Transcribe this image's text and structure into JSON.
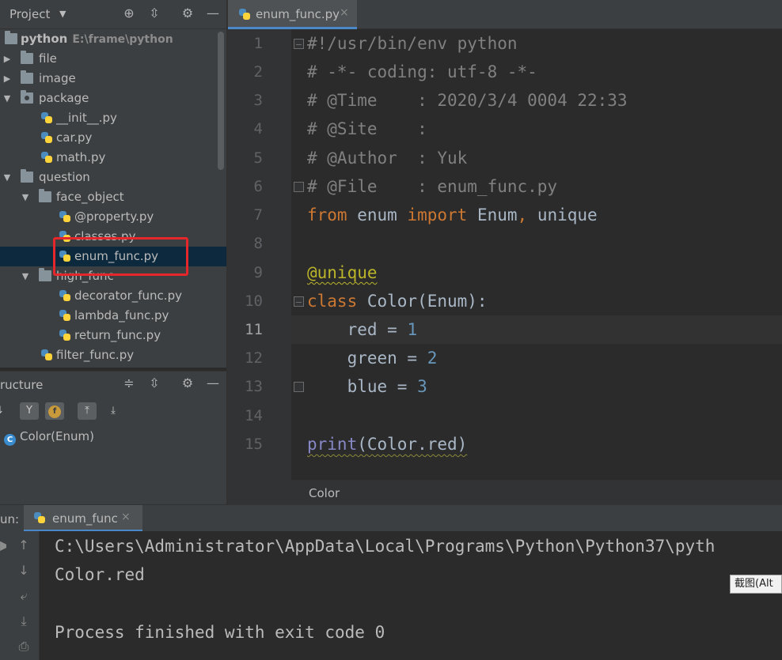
{
  "project_panel": {
    "title": "Project",
    "tree": [
      {
        "label": "python",
        "path": "E:\\frame\\python",
        "type": "folder",
        "expanded": true,
        "bold": true
      },
      {
        "label": "file",
        "type": "folder",
        "expanded": false
      },
      {
        "label": "image",
        "type": "folder",
        "expanded": false
      },
      {
        "label": "package",
        "type": "package",
        "expanded": true
      },
      {
        "label": "__init__.py",
        "type": "py"
      },
      {
        "label": "car.py",
        "type": "py"
      },
      {
        "label": "math.py",
        "type": "py"
      },
      {
        "label": "question",
        "type": "folder",
        "expanded": true
      },
      {
        "label": "face_object",
        "type": "folder",
        "expanded": true
      },
      {
        "label": "@property.py",
        "type": "py"
      },
      {
        "label": "classes.py",
        "type": "py"
      },
      {
        "label": "enum_func.py",
        "type": "py",
        "selected": true
      },
      {
        "label": "high_func",
        "type": "folder",
        "expanded": true
      },
      {
        "label": "decorator_func.py",
        "type": "py"
      },
      {
        "label": "lambda_func.py",
        "type": "py"
      },
      {
        "label": "return_func.py",
        "type": "py"
      },
      {
        "label": "filter_func.py",
        "type": "py"
      }
    ]
  },
  "structure_panel": {
    "title": "ructure",
    "item": "Color(Enum)",
    "item_icon": "C"
  },
  "editor": {
    "tab_label": "enum_func.py",
    "line_numbers": [
      "1",
      "2",
      "3",
      "4",
      "5",
      "6",
      "7",
      "8",
      "9",
      "10",
      "11",
      "12",
      "13",
      "14",
      "15"
    ],
    "breadcrumb": "Color"
  },
  "run_panel": {
    "label": "un:",
    "tab_label": "enum_func",
    "output": [
      "C:\\Users\\Administrator\\AppData\\Local\\Programs\\Python\\Python37\\pyth",
      "Color.red",
      "",
      "Process finished with exit code 0"
    ]
  },
  "tooltip": "截图(Alt",
  "icons": {
    "locate": "crosshair-icon",
    "collapse": "collapse-icon",
    "settings": "gear-icon",
    "hide": "minimize-icon"
  },
  "colors": {
    "selection": "#0d293e",
    "highlight_box": "#e5262a",
    "keyword": "#cc7832",
    "number": "#6897bb",
    "comment": "#808080",
    "decorator": "#bbb529"
  }
}
